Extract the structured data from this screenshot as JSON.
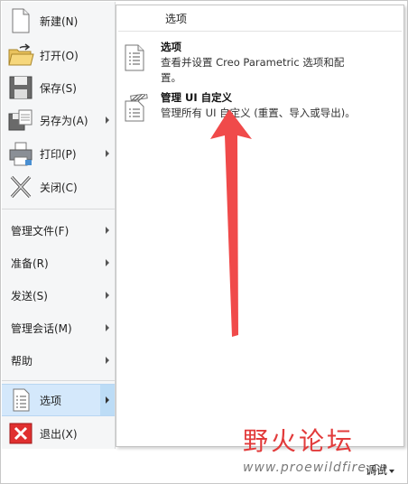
{
  "menu": {
    "items": [
      {
        "label": "新建(N)",
        "icon": "new-document-icon"
      },
      {
        "label": "打开(O)",
        "icon": "open-folder-icon"
      },
      {
        "label": "保存(S)",
        "icon": "save-icon"
      },
      {
        "label": "另存为(A)",
        "icon": "save-as-icon"
      },
      {
        "label": "打印(P)",
        "icon": "print-icon"
      },
      {
        "label": "关闭(C)",
        "icon": "close-icon"
      },
      {
        "label": "管理文件(F)"
      },
      {
        "label": "准备(R)"
      },
      {
        "label": "发送(S)"
      },
      {
        "label": "管理会话(M)"
      },
      {
        "label": "帮助"
      },
      {
        "label": "选项",
        "icon": "options-icon"
      },
      {
        "label": "退出(X)",
        "icon": "exit-icon"
      }
    ]
  },
  "panel": {
    "title": "选项",
    "items": [
      {
        "title": "选项",
        "desc": "查看并设置 Creo Parametric 选项和配置。",
        "icon": "options-list-icon"
      },
      {
        "title": "管理 UI 自定义",
        "desc": "管理所有 UI 自定义 (重置、导入或导出)。",
        "icon": "ui-customize-icon"
      }
    ]
  },
  "watermark": {
    "logo": "野火论坛",
    "url": "www.proewildfire.cn"
  },
  "status": {
    "debug": "调试"
  },
  "colors": {
    "accent": "#d4e8fb",
    "arrow": "#f04a4a",
    "exit": "#e03030"
  }
}
